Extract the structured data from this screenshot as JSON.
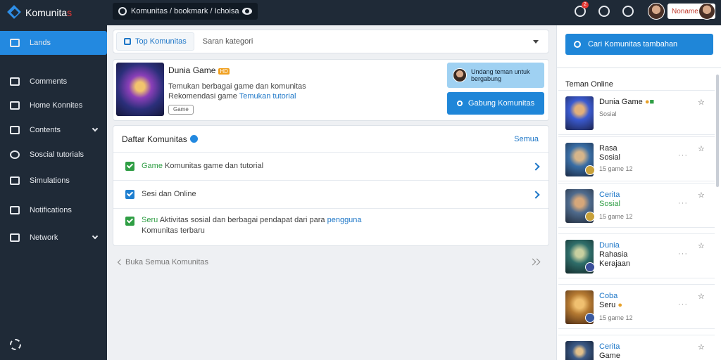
{
  "app": {
    "brand": "Komunita",
    "brand_suffix": "s"
  },
  "topbar": {
    "search_value": "Komunitas / bookmark / Ichoisa",
    "notification_count": "2",
    "user_label": "Noname"
  },
  "sidebar": {
    "items": [
      {
        "label": "Lands",
        "icon": "grid-icon"
      },
      {
        "label": "Comments",
        "icon": "stack-icon"
      },
      {
        "label": "Home Konnites",
        "icon": "bookmark-icon"
      },
      {
        "label": "Contents",
        "icon": "folder-icon"
      },
      {
        "label": "Soscial tutorials",
        "icon": "compass-icon"
      },
      {
        "label": "Simulations",
        "icon": "network-icon"
      },
      {
        "label": "Notifications",
        "icon": "inbox-icon"
      },
      {
        "label": "Network",
        "icon": "server-icon"
      }
    ]
  },
  "filter": {
    "chip_label": "Top Komunitas",
    "text": "Saran kategori"
  },
  "game": {
    "title": "Dunia Game",
    "badge": "HD",
    "desc1": "Temukan berbagai game dan komunitas",
    "desc2_prefix": "Rekomendasi game",
    "desc2_link": "Temukan tutorial",
    "tag": "Game"
  },
  "invite": {
    "text": "Undang teman untuk bergabung",
    "button": "Gabung Komunitas"
  },
  "list": {
    "title": "Daftar Komunitas",
    "link": "Semua",
    "rows": [
      {
        "lead": "Game",
        "text": "Komunitas game dan tutorial"
      },
      {
        "lead": "",
        "text": "Sesi dan Online"
      },
      {
        "lead": "Seru",
        "text": "Aktivitas sosial dan berbagai pendapat dari para",
        "link": "pengguna",
        "second": "Komunitas terbaru"
      }
    ]
  },
  "pager": {
    "label": "Buka Semua Komunitas"
  },
  "right": {
    "button": "Cari Komunitas tambahan",
    "title": "Teman Online",
    "people": [
      {
        "name": "Dunia Game",
        "sub": "Sosial",
        "color": "#3b5bd1"
      },
      {
        "name": "Rasa",
        "name2": "Sosial",
        "sub": "15 game 12",
        "color": "#3a6ea5"
      },
      {
        "name": "Cerita",
        "name2": "Sosial",
        "sub": "15 game 12",
        "color": "#4f6b8d",
        "blue": true
      },
      {
        "name": "Dunia",
        "name2": "Rahasia",
        "name3": "Kerajaan",
        "sub": "15 game 12",
        "color": "#2f6e6a",
        "blue": true
      },
      {
        "name": "Coba",
        "name2": "Seru",
        "sub": "15 game 12",
        "color": "#b57a32",
        "blue": true
      },
      {
        "name": "Cerita",
        "name2": "Game",
        "sub": "",
        "color": "#3c5a86",
        "blue": true
      }
    ]
  }
}
